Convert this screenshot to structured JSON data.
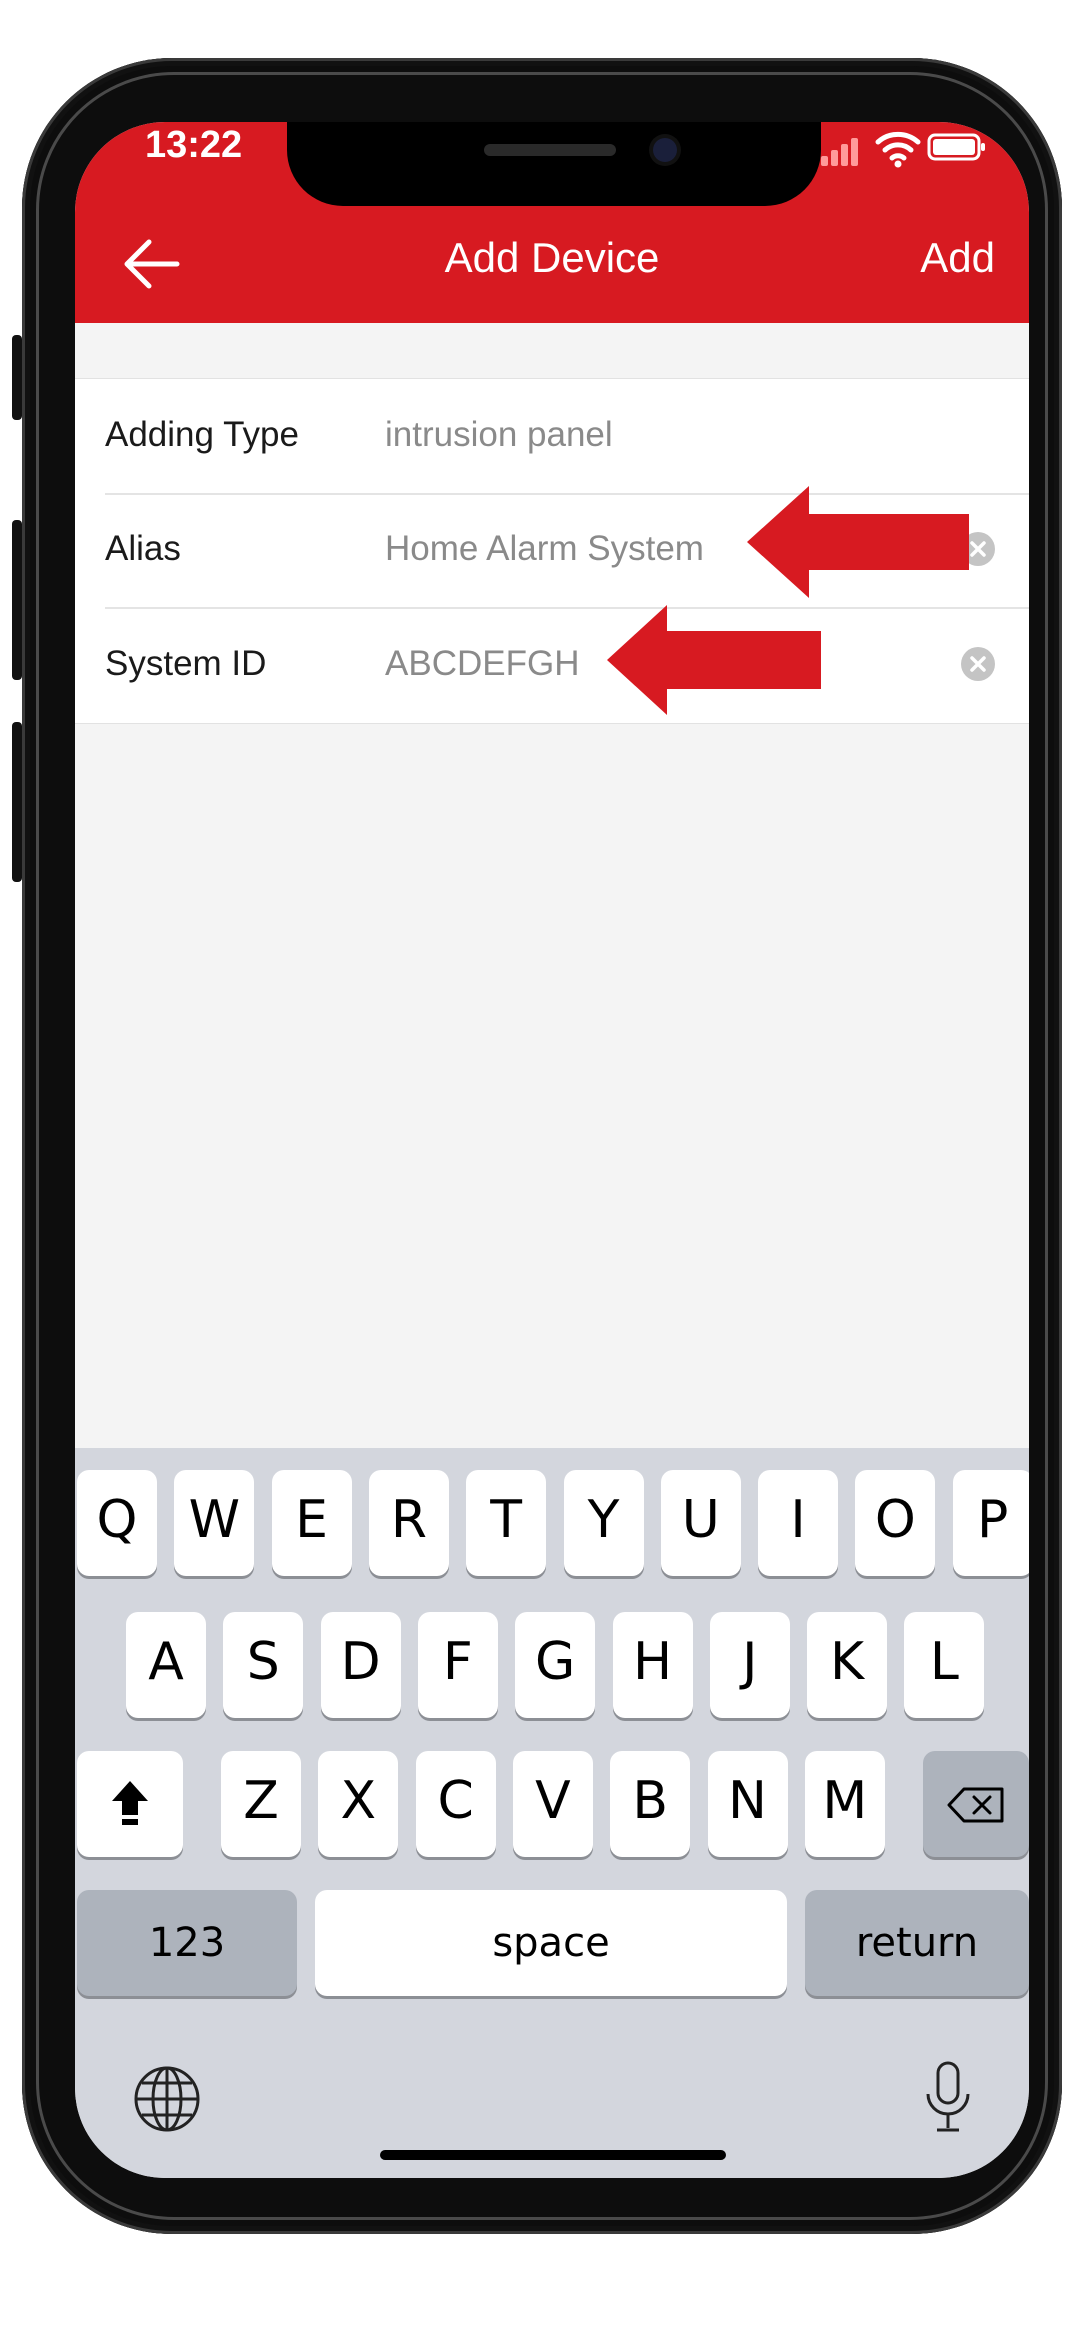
{
  "status_bar": {
    "time": "13:22"
  },
  "header": {
    "title": "Add Device",
    "add_label": "Add"
  },
  "form": {
    "rows": [
      {
        "label": "Adding Type",
        "value": "intrusion panel"
      },
      {
        "label": "Alias",
        "value": "Home Alarm System"
      },
      {
        "label": "System ID",
        "value": "ABCDEFGH"
      }
    ]
  },
  "keyboard": {
    "row1": [
      "Q",
      "W",
      "E",
      "R",
      "T",
      "Y",
      "U",
      "I",
      "O",
      "P"
    ],
    "row2": [
      "A",
      "S",
      "D",
      "F",
      "G",
      "H",
      "J",
      "K",
      "L"
    ],
    "row3": [
      "Z",
      "X",
      "C",
      "V",
      "B",
      "N",
      "M"
    ],
    "numbers_label": "123",
    "space_label": "space",
    "return_label": "return"
  },
  "icons": {
    "back": "arrow-left-icon",
    "clear": "clear-circle-x-icon",
    "shift": "shift-icon",
    "delete": "backspace-icon",
    "globe": "globe-icon",
    "mic": "microphone-icon",
    "wifi": "wifi-icon",
    "battery": "battery-icon",
    "annotation_arrow": "red-arrow-left-icon"
  },
  "colors": {
    "brand_red": "#d71a21",
    "screen_bg": "#f4f4f4",
    "keyboard_bg": "#d3d6dd",
    "value_gray": "#8a8a8a"
  }
}
